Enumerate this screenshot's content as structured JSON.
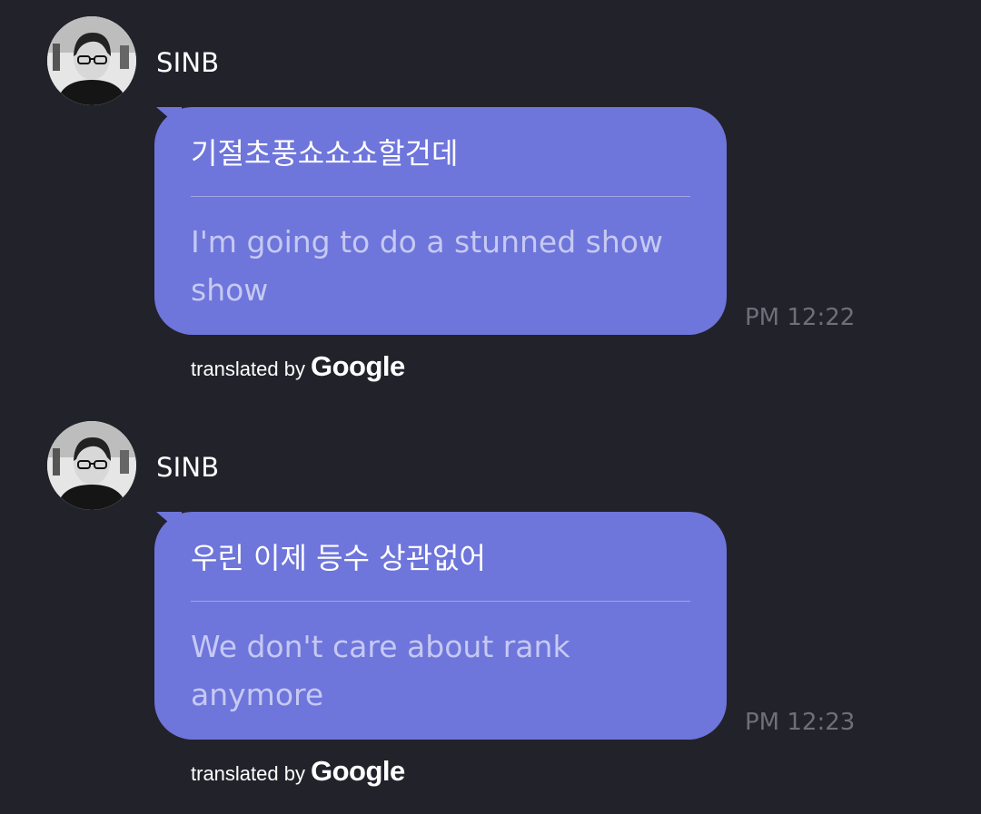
{
  "messages": [
    {
      "sender": "SINB",
      "original": "기절초풍쇼쇼쇼할건데",
      "translation": "I'm going to do a stunned show show",
      "time": "PM 12:22",
      "attribution_prefix": "translated by",
      "attribution_brand": "Google"
    },
    {
      "sender": "SINB",
      "original": "우린 이제 등수 상관없어",
      "translation": "We don't care about rank anymore",
      "time": "PM 12:23",
      "attribution_prefix": "translated by",
      "attribution_brand": "Google"
    }
  ],
  "colors": {
    "background": "#22222b",
    "bubble": "#6e75db",
    "translation_text": "#c6c9f2",
    "timestamp": "#6f6f78"
  }
}
